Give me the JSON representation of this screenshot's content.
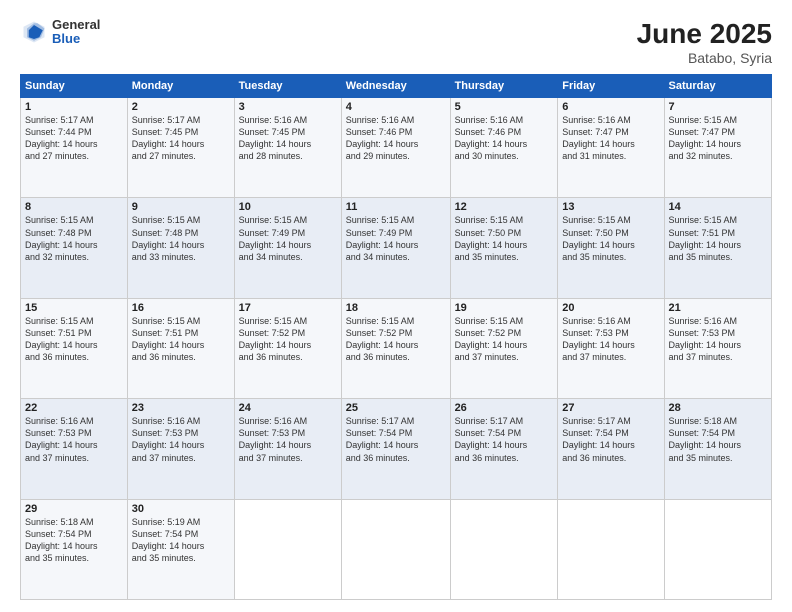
{
  "header": {
    "logo_general": "General",
    "logo_blue": "Blue",
    "title": "June 2025",
    "subtitle": "Batabo, Syria"
  },
  "days_of_week": [
    "Sunday",
    "Monday",
    "Tuesday",
    "Wednesday",
    "Thursday",
    "Friday",
    "Saturday"
  ],
  "weeks": [
    [
      {
        "day": "1",
        "info": "Sunrise: 5:17 AM\nSunset: 7:44 PM\nDaylight: 14 hours\nand 27 minutes."
      },
      {
        "day": "2",
        "info": "Sunrise: 5:17 AM\nSunset: 7:45 PM\nDaylight: 14 hours\nand 27 minutes."
      },
      {
        "day": "3",
        "info": "Sunrise: 5:16 AM\nSunset: 7:45 PM\nDaylight: 14 hours\nand 28 minutes."
      },
      {
        "day": "4",
        "info": "Sunrise: 5:16 AM\nSunset: 7:46 PM\nDaylight: 14 hours\nand 29 minutes."
      },
      {
        "day": "5",
        "info": "Sunrise: 5:16 AM\nSunset: 7:46 PM\nDaylight: 14 hours\nand 30 minutes."
      },
      {
        "day": "6",
        "info": "Sunrise: 5:16 AM\nSunset: 7:47 PM\nDaylight: 14 hours\nand 31 minutes."
      },
      {
        "day": "7",
        "info": "Sunrise: 5:15 AM\nSunset: 7:47 PM\nDaylight: 14 hours\nand 32 minutes."
      }
    ],
    [
      {
        "day": "8",
        "info": "Sunrise: 5:15 AM\nSunset: 7:48 PM\nDaylight: 14 hours\nand 32 minutes."
      },
      {
        "day": "9",
        "info": "Sunrise: 5:15 AM\nSunset: 7:48 PM\nDaylight: 14 hours\nand 33 minutes."
      },
      {
        "day": "10",
        "info": "Sunrise: 5:15 AM\nSunset: 7:49 PM\nDaylight: 14 hours\nand 34 minutes."
      },
      {
        "day": "11",
        "info": "Sunrise: 5:15 AM\nSunset: 7:49 PM\nDaylight: 14 hours\nand 34 minutes."
      },
      {
        "day": "12",
        "info": "Sunrise: 5:15 AM\nSunset: 7:50 PM\nDaylight: 14 hours\nand 35 minutes."
      },
      {
        "day": "13",
        "info": "Sunrise: 5:15 AM\nSunset: 7:50 PM\nDaylight: 14 hours\nand 35 minutes."
      },
      {
        "day": "14",
        "info": "Sunrise: 5:15 AM\nSunset: 7:51 PM\nDaylight: 14 hours\nand 35 minutes."
      }
    ],
    [
      {
        "day": "15",
        "info": "Sunrise: 5:15 AM\nSunset: 7:51 PM\nDaylight: 14 hours\nand 36 minutes."
      },
      {
        "day": "16",
        "info": "Sunrise: 5:15 AM\nSunset: 7:51 PM\nDaylight: 14 hours\nand 36 minutes."
      },
      {
        "day": "17",
        "info": "Sunrise: 5:15 AM\nSunset: 7:52 PM\nDaylight: 14 hours\nand 36 minutes."
      },
      {
        "day": "18",
        "info": "Sunrise: 5:15 AM\nSunset: 7:52 PM\nDaylight: 14 hours\nand 36 minutes."
      },
      {
        "day": "19",
        "info": "Sunrise: 5:15 AM\nSunset: 7:52 PM\nDaylight: 14 hours\nand 37 minutes."
      },
      {
        "day": "20",
        "info": "Sunrise: 5:16 AM\nSunset: 7:53 PM\nDaylight: 14 hours\nand 37 minutes."
      },
      {
        "day": "21",
        "info": "Sunrise: 5:16 AM\nSunset: 7:53 PM\nDaylight: 14 hours\nand 37 minutes."
      }
    ],
    [
      {
        "day": "22",
        "info": "Sunrise: 5:16 AM\nSunset: 7:53 PM\nDaylight: 14 hours\nand 37 minutes."
      },
      {
        "day": "23",
        "info": "Sunrise: 5:16 AM\nSunset: 7:53 PM\nDaylight: 14 hours\nand 37 minutes."
      },
      {
        "day": "24",
        "info": "Sunrise: 5:16 AM\nSunset: 7:53 PM\nDaylight: 14 hours\nand 37 minutes."
      },
      {
        "day": "25",
        "info": "Sunrise: 5:17 AM\nSunset: 7:54 PM\nDaylight: 14 hours\nand 36 minutes."
      },
      {
        "day": "26",
        "info": "Sunrise: 5:17 AM\nSunset: 7:54 PM\nDaylight: 14 hours\nand 36 minutes."
      },
      {
        "day": "27",
        "info": "Sunrise: 5:17 AM\nSunset: 7:54 PM\nDaylight: 14 hours\nand 36 minutes."
      },
      {
        "day": "28",
        "info": "Sunrise: 5:18 AM\nSunset: 7:54 PM\nDaylight: 14 hours\nand 35 minutes."
      }
    ],
    [
      {
        "day": "29",
        "info": "Sunrise: 5:18 AM\nSunset: 7:54 PM\nDaylight: 14 hours\nand 35 minutes."
      },
      {
        "day": "30",
        "info": "Sunrise: 5:19 AM\nSunset: 7:54 PM\nDaylight: 14 hours\nand 35 minutes."
      },
      null,
      null,
      null,
      null,
      null
    ]
  ]
}
